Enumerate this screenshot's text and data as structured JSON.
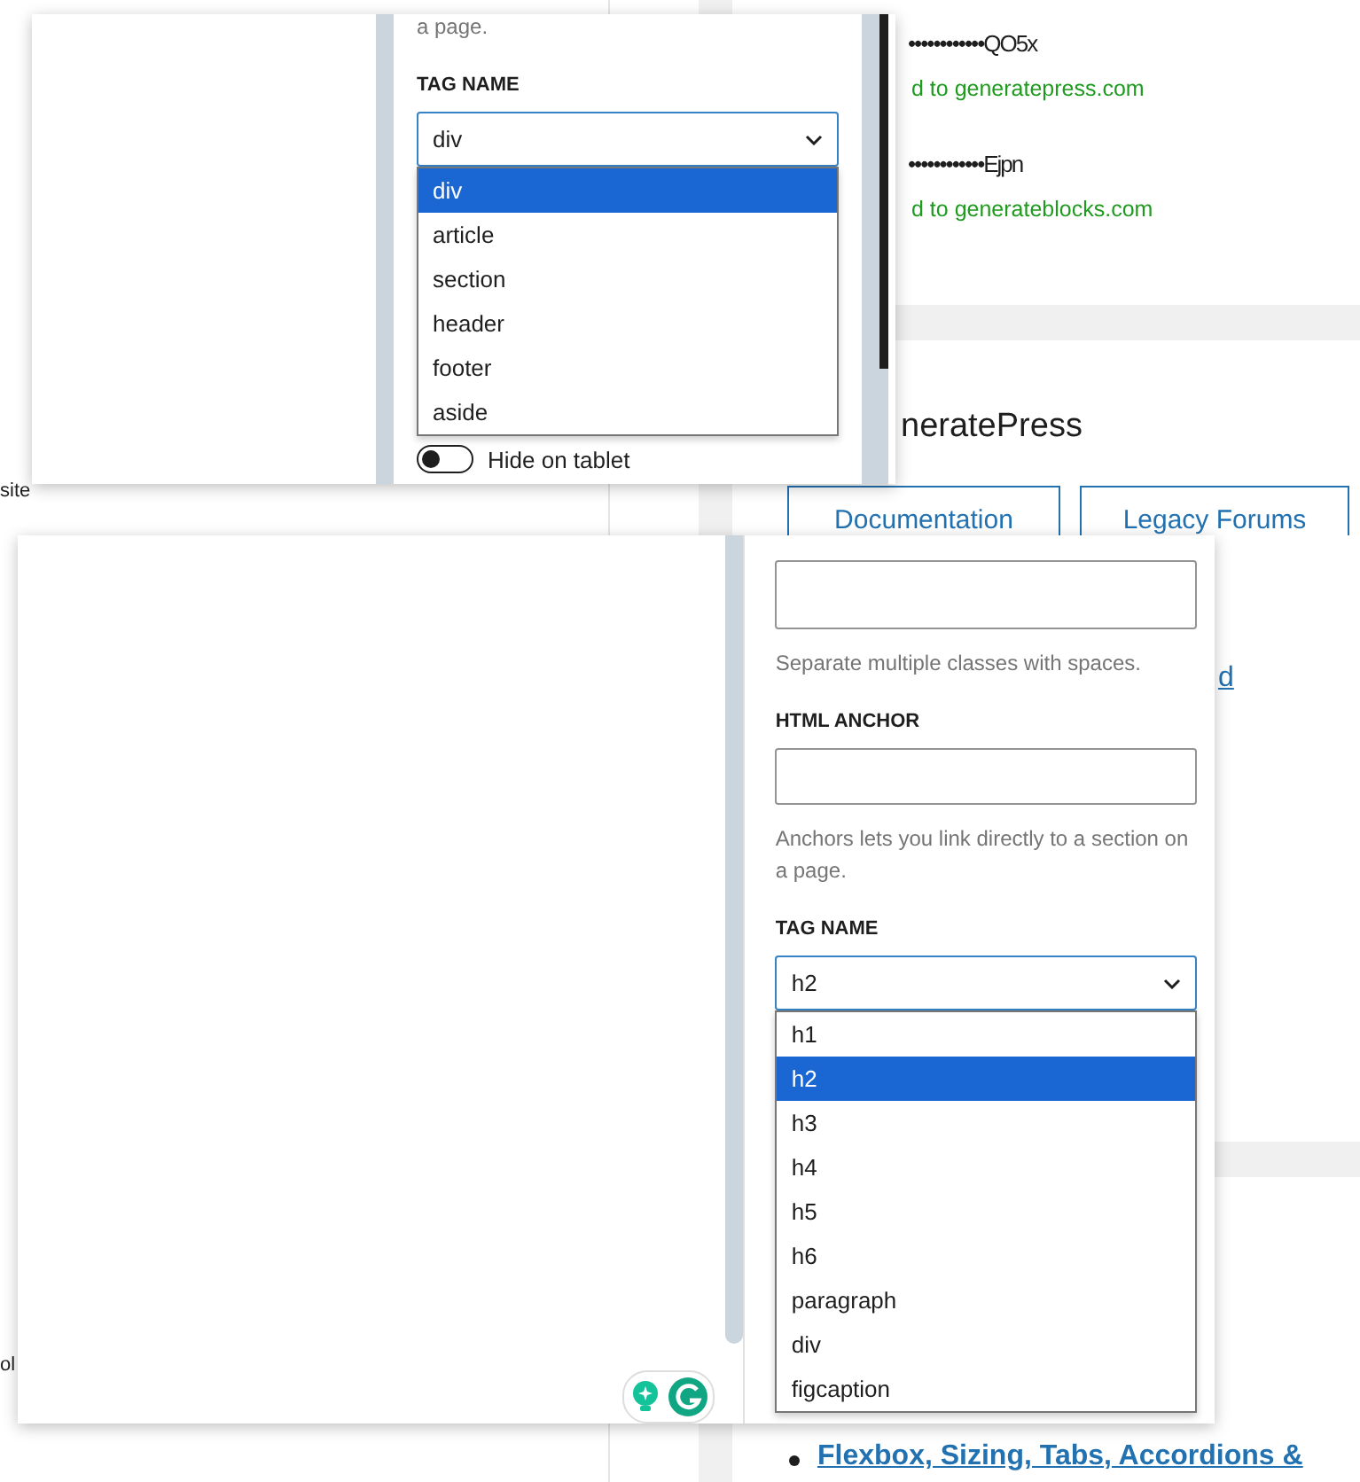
{
  "background_page": {
    "left_fragments": [
      "site",
      "ol"
    ],
    "license_keys": [
      {
        "key": "••••••••••••QO5x",
        "status": "d to generatepress.com"
      },
      {
        "key": "••••••••••••Ejpn",
        "status": "d to generateblocks.com"
      }
    ],
    "heading": "neratePress",
    "buttons": [
      "Documentation",
      "Legacy Forums"
    ],
    "link_fragment": "d",
    "list_link": "Flexbox, Sizing, Tabs, Accordions &"
  },
  "panel_top": {
    "help_tail": "a page.",
    "tag_label": "TAG NAME",
    "select_value": "div",
    "options": [
      {
        "label": "div",
        "selected": true
      },
      {
        "label": "article",
        "selected": false
      },
      {
        "label": "section",
        "selected": false
      },
      {
        "label": "header",
        "selected": false
      },
      {
        "label": "footer",
        "selected": false
      },
      {
        "label": "aside",
        "selected": false
      }
    ],
    "toggle": {
      "label": "Hide on tablet",
      "on": false
    }
  },
  "panel_bottom": {
    "class_help": "Separate multiple classes with spaces.",
    "anchor_label": "HTML ANCHOR",
    "anchor_help": "Anchors lets you link directly to a section on a page.",
    "tag_label": "TAG NAME",
    "select_value": "h2",
    "options": [
      {
        "label": "h1",
        "selected": false
      },
      {
        "label": "h2",
        "selected": true
      },
      {
        "label": "h3",
        "selected": false
      },
      {
        "label": "h4",
        "selected": false
      },
      {
        "label": "h5",
        "selected": false
      },
      {
        "label": "h6",
        "selected": false
      },
      {
        "label": "paragraph",
        "selected": false
      },
      {
        "label": "div",
        "selected": false
      },
      {
        "label": "figcaption",
        "selected": false
      }
    ]
  }
}
